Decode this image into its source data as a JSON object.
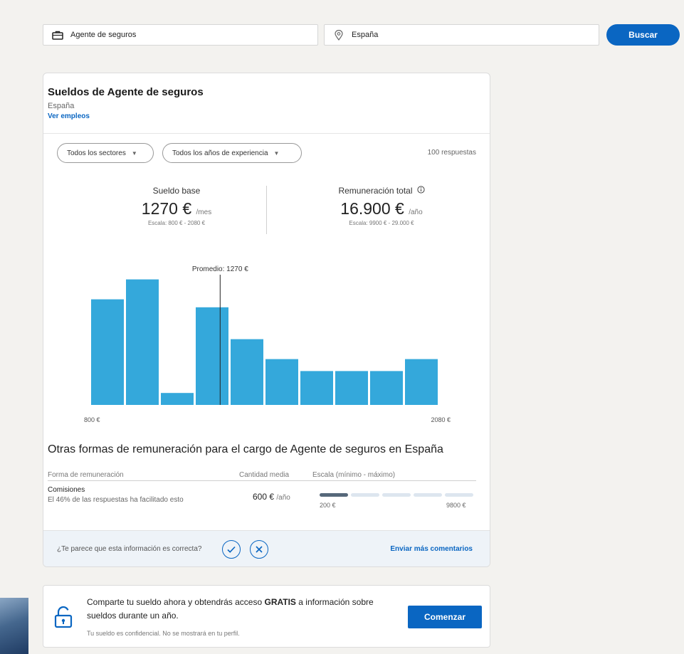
{
  "search": {
    "keyword_value": "Agente de seguros",
    "location_value": "España",
    "submit_label": "Buscar"
  },
  "salary_card": {
    "title": "Sueldos de Agente de seguros",
    "location": "España",
    "jobs_link": "Ver empleos",
    "filters": {
      "sector_label": "Todos los sectores",
      "experience_label": "Todos los años de experiencia"
    },
    "responses": "100 respuestas",
    "base": {
      "label": "Sueldo base",
      "value": "1270 €",
      "unit": "/mes",
      "range": "Escala: 800 € - 2080 €"
    },
    "total": {
      "label": "Remuneración total",
      "value": "16.900 €",
      "unit": "/año",
      "range": "Escala: 9900 € - 29.000 €"
    },
    "other_comp": {
      "title": "Otras formas de remuneración para el cargo de Agente de seguros en España",
      "headers": [
        "Forma de remuneración",
        "Cantidad media",
        "Escala (mínimo - máximo)"
      ],
      "rows": [
        {
          "name": "Comisiones",
          "desc": "El 46% de las respuestas ha facilitado esto",
          "amount": "600 €",
          "unit": "/año",
          "min": "200 €",
          "max": "9800 €",
          "segments": 5,
          "active_segments": 1
        }
      ]
    },
    "feedback": {
      "question": "¿Te parece que esta información es correcta?",
      "link": "Enviar más comentarios"
    }
  },
  "chart_data": {
    "type": "bar",
    "x_start_label": "800 €",
    "x_end_label": "2080 €",
    "values": [
      53,
      63,
      6,
      49,
      33,
      23,
      17,
      17,
      17,
      23
    ],
    "ylim": [
      0,
      70
    ],
    "marker_label": "Promedio: 1270 €",
    "marker_position": 3.7,
    "bar_color": "#34a8db"
  },
  "promo": {
    "text_before": "Comparte tu sueldo ahora y obtendrás acceso ",
    "text_bold": "GRATIS",
    "text_after": " a información sobre sueldos durante un año.",
    "note": "Tu sueldo es confidencial. No se mostrará en tu perfil.",
    "button_label": "Comenzar"
  }
}
